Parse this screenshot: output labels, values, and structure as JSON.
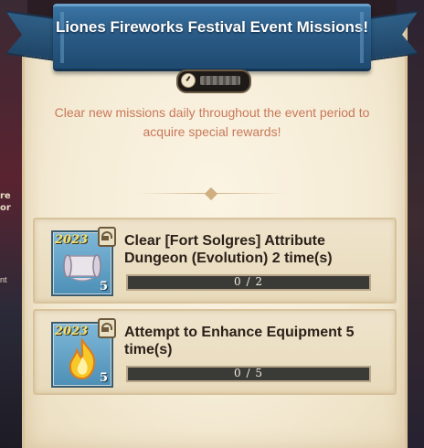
{
  "event": {
    "title": "Liones Fireworks Festival Event Missions!",
    "timer_icon": "clock-icon",
    "description": "Clear new missions daily throughout the event period to acquire special rewards!"
  },
  "background": {
    "left_text": "re or",
    "left_text2": "nt"
  },
  "missions": [
    {
      "text": "Clear [Fort Solgres] Attribute Dungeon (Evolution) 2 time(s)",
      "reward_year": "2023",
      "reward_count": "5",
      "reward_icon": "scroll-icon",
      "progress_text": "0 / 2",
      "progress_fraction": 0.0
    },
    {
      "text": "Attempt to Enhance Equipment 5 time(s)",
      "reward_year": "2023",
      "reward_count": "5",
      "reward_icon": "flame-icon",
      "progress_text": "0 / 5",
      "progress_fraction": 0.0
    }
  ],
  "colors": {
    "ribbon": "#2a5b86",
    "description_text": "#c9785a",
    "parchment": "#f5ecd6"
  }
}
